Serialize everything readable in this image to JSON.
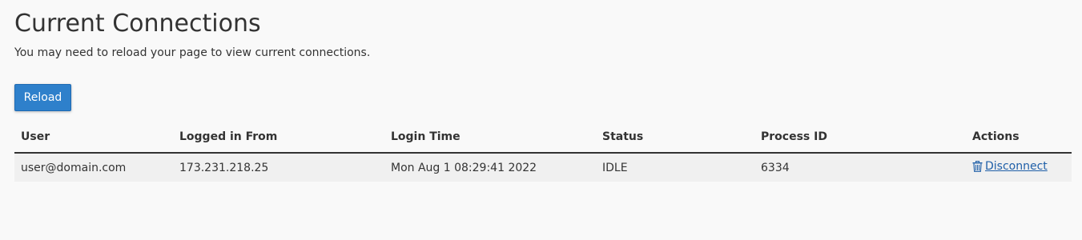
{
  "page": {
    "title": "Current Connections",
    "subtitle": "You may need to reload your page to view current connections."
  },
  "toolbar": {
    "reload_label": "Reload"
  },
  "table": {
    "columns": [
      "User",
      "Logged in From",
      "Login Time",
      "Status",
      "Process ID",
      "Actions"
    ],
    "rows": [
      {
        "user": "user@domain.com",
        "from": "173.231.218.25",
        "login_time": "Mon Aug 1 08:29:41 2022",
        "status": "IDLE",
        "pid": "6334",
        "action_label": "Disconnect",
        "action_icon": "trash-icon"
      }
    ]
  },
  "colors": {
    "accent": "#2e80cb",
    "link": "#1f5fa8",
    "background": "#f9f9f9",
    "row_background": "#f0f0f0"
  }
}
